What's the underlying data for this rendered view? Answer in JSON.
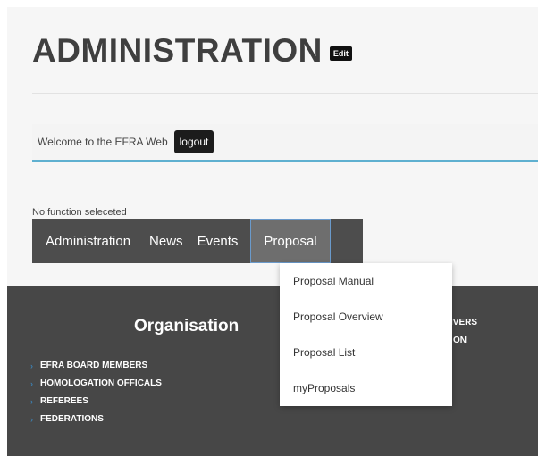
{
  "header": {
    "title": "ADMINISTRATION",
    "edit_label": "Edit"
  },
  "welcome": {
    "text": "Welcome to the EFRA Web",
    "logout_label": "logout"
  },
  "status": {
    "text": "No function seleceted"
  },
  "nav": {
    "items": [
      {
        "label": "Administration"
      },
      {
        "label": "News"
      },
      {
        "label": "Events"
      },
      {
        "label": "Proposal"
      }
    ],
    "active": "Proposal"
  },
  "dropdown": {
    "items": [
      {
        "label": "Proposal Manual"
      },
      {
        "label": "Proposal Overview"
      },
      {
        "label": "Proposal List"
      },
      {
        "label": "myProposals"
      }
    ]
  },
  "footer": {
    "heading": "Organisation",
    "links": [
      {
        "label": "EFRA BOARD MEMBERS"
      },
      {
        "label": "HOMOLOGATION OFFICALS"
      },
      {
        "label": "REFEREES"
      },
      {
        "label": "FEDERATIONS"
      }
    ],
    "partial_links": [
      "IVERS",
      "ON"
    ]
  },
  "colors": {
    "accent": "#5fb0d0",
    "nav_bg": "#4d4d4d",
    "footer_bg": "#474747",
    "chevron": "#3e7fae"
  }
}
